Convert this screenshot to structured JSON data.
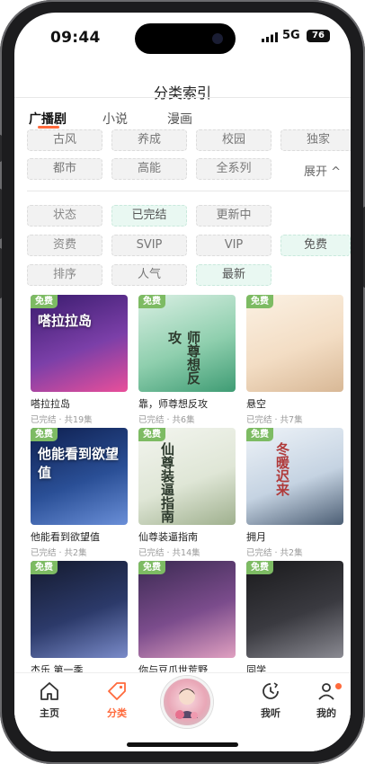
{
  "status_bar": {
    "time": "09:44",
    "network": "5G",
    "battery": "76"
  },
  "header": {
    "title": "分类索引"
  },
  "tabs": [
    {
      "label": "广播剧",
      "active": true
    },
    {
      "label": "小说",
      "active": false
    },
    {
      "label": "漫画",
      "active": false
    }
  ],
  "filters": {
    "genre_row1": [
      "古风",
      "养成",
      "校园",
      "独家"
    ],
    "genre_row2": [
      "都市",
      "高能",
      "全系列"
    ],
    "expand_label": "展开 ^",
    "status_row": {
      "label": "状态",
      "options": [
        "已完结",
        "更新中"
      ],
      "selected": "已完结"
    },
    "fee_row": {
      "label": "资费",
      "options": [
        "SVIP",
        "VIP",
        "免费"
      ],
      "selected": "免费"
    },
    "sort_row": {
      "label": "排序",
      "options": [
        "人气",
        "最新"
      ],
      "selected": "最新"
    }
  },
  "cards": [
    {
      "badge": "免费",
      "cover_title": "嗒拉拉岛",
      "name": "嗒拉拉岛",
      "meta": "已完结 · 共19集",
      "colors": [
        "#3a1c6e",
        "#7b3fa8",
        "#e94f9a"
      ]
    },
    {
      "badge": "免费",
      "cover_title": "师尊想反攻",
      "name": "靠，师尊想反攻",
      "meta": "已完结 · 共6集",
      "colors": [
        "#d9efe3",
        "#8fcfae",
        "#3f9c74"
      ]
    },
    {
      "badge": "免费",
      "cover_title": "",
      "name": "悬空",
      "meta": "已完结 · 共7集",
      "colors": [
        "#fbf1e3",
        "#f3ddc4",
        "#d8b896"
      ]
    },
    {
      "badge": "免费",
      "cover_title": "他能看到欲望值",
      "name": "他能看到欲望值",
      "meta": "已完结 · 共2集",
      "colors": [
        "#0e1f4f",
        "#2a4f96",
        "#6a8fd8"
      ]
    },
    {
      "badge": "免费",
      "cover_title": "仙尊装逼指南",
      "name": "仙尊装逼指南",
      "meta": "已完结 · 共14集",
      "colors": [
        "#f3f5ef",
        "#dfe6d6",
        "#9fb08e"
      ]
    },
    {
      "badge": "免费",
      "cover_title": "冬暖迟来",
      "name": "拥月",
      "meta": "已完结 · 共2集",
      "colors": [
        "#eef3f8",
        "#c5d3e2",
        "#4c5e74"
      ]
    },
    {
      "badge": "免费",
      "cover_title": "",
      "name": "杰乐 第一季",
      "meta": "",
      "colors": [
        "#141a2e",
        "#2c3a6a",
        "#7a8bc9"
      ]
    },
    {
      "badge": "免费",
      "cover_title": "",
      "name": "你与豆爪世荒野",
      "meta": "",
      "colors": [
        "#3b2a52",
        "#7b4c8c",
        "#e0a0c0"
      ]
    },
    {
      "badge": "免费",
      "cover_title": "",
      "name": "同学",
      "meta": "",
      "colors": [
        "#1a1a1c",
        "#3a3a40",
        "#8a8a92"
      ]
    }
  ],
  "bottom_nav": [
    {
      "label": "主页",
      "icon": "home-icon",
      "active": false
    },
    {
      "label": "分类",
      "icon": "tag-icon",
      "active": true
    },
    {
      "label": "",
      "icon": "center-avatar",
      "active": false
    },
    {
      "label": "我听",
      "icon": "clock-icon",
      "active": false
    },
    {
      "label": "我的",
      "icon": "profile-icon",
      "active": false,
      "dot": true
    }
  ],
  "accent": "#ff6a3c",
  "badge_color": "#7dbb63"
}
